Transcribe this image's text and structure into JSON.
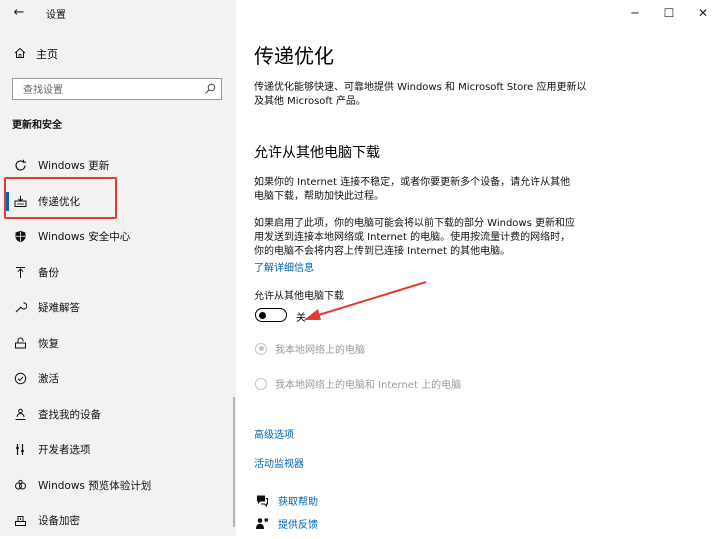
{
  "window": {
    "title": "设置",
    "back_icon": "back-arrow-icon",
    "controls": {
      "minimize": "─",
      "maximize": "☐",
      "close": "✕"
    }
  },
  "sidebar": {
    "home_label": "主页",
    "search": {
      "placeholder": "查找设置",
      "value": ""
    },
    "section_title": "更新和安全",
    "items": [
      {
        "label": "Windows 更新",
        "icon": "refresh-icon"
      },
      {
        "label": "传递优化",
        "icon": "delivery-optimization-icon",
        "active": true
      },
      {
        "label": "Windows 安全中心",
        "icon": "shield-icon"
      },
      {
        "label": "备份",
        "icon": "backup-arrow-icon"
      },
      {
        "label": "疑难解答",
        "icon": "wrench-icon"
      },
      {
        "label": "恢复",
        "icon": "recovery-icon"
      },
      {
        "label": "激活",
        "icon": "check-circle-icon"
      },
      {
        "label": "查找我的设备",
        "icon": "person-pin-icon"
      },
      {
        "label": "开发者选项",
        "icon": "developer-icon"
      },
      {
        "label": "Windows 预览体验计划",
        "icon": "insider-icon"
      },
      {
        "label": "设备加密",
        "icon": "encryption-icon"
      }
    ]
  },
  "main": {
    "page_title": "传递优化",
    "intro_line1": "传递优化能够快速、可靠地提供 Windows 和 Microsoft Store 应用更新以",
    "intro_line2": "及其他 Microsoft 产品。",
    "section_title": "允许从其他电脑下载",
    "para1_line1": "如果你的 Internet 连接不稳定，或者你要更新多个设备，请允许从其他",
    "para1_line2": "电脑下载，帮助加快此过程。",
    "para2_line1": "如果启用了此项，你的电脑可能会将以前下载的部分 Windows 更新和应",
    "para2_line2": "用发送到连接本地网络或 Internet 的电脑。使用按流量计费的网络时，",
    "para2_line3": "你的电脑不会将内容上传到已连接 Internet 的其他电脑。",
    "learn_more": "了解详细信息",
    "toggle": {
      "label": "允许从其他电脑下载",
      "state": "关",
      "on": false
    },
    "radio_local": "我本地网络上的电脑",
    "radio_internet": "我本地网络上的电脑和 Internet 上的电脑",
    "advanced_link": "高级选项",
    "monitor_link": "活动监视器",
    "get_help": "获取帮助",
    "feedback": "提供反馈"
  },
  "colors": {
    "sidebar_bg": "#f2f2f2",
    "accent": "#0063b1",
    "annotation_red": "#e53935",
    "disabled_text": "#9a9a9a"
  }
}
